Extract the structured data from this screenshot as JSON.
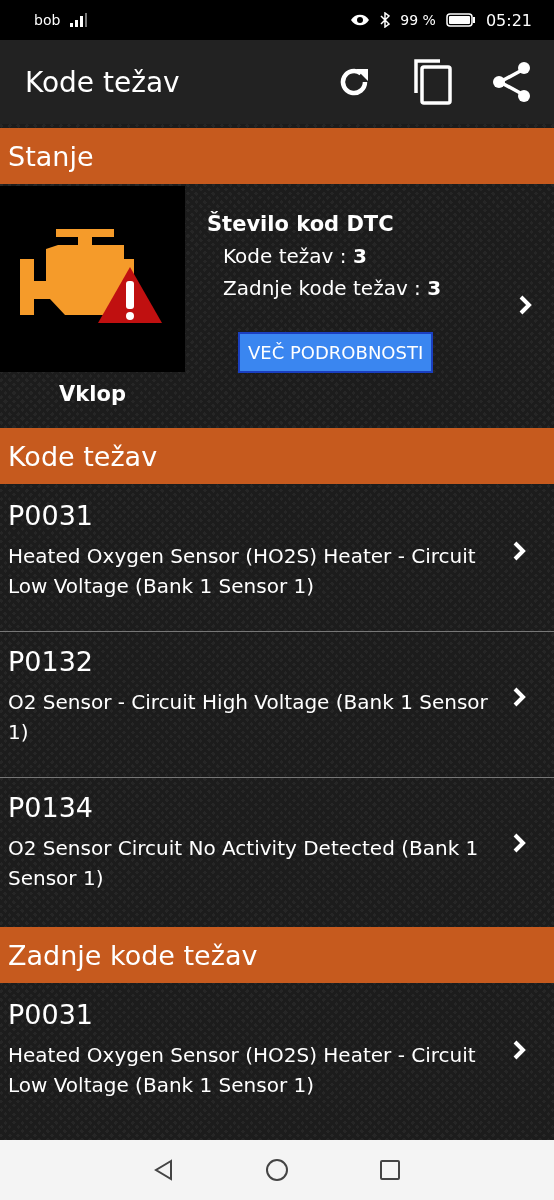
{
  "status_bar": {
    "carrier": "bob",
    "battery": "99 %",
    "time": "05:21"
  },
  "app_bar": {
    "title": "Kode težav"
  },
  "sections": [
    {
      "kind": "status",
      "title": "Stanje",
      "state": "Vklop",
      "heading": "Število kod DTC",
      "counts": [
        "Kode težav : **3**",
        "Zadnje kode težav : **3**"
      ],
      "button": "VEČ PODROBNOSTI"
    },
    {
      "kind": "codes",
      "title": "Kode težav",
      "items": [
        {
          "code": "P0031",
          "description": "Heated Oxygen Sensor (HO2S) Heater - Circuit Low Voltage (Bank 1 Sensor 1)"
        },
        {
          "code": "P0132",
          "description": "O2 Sensor - Circuit High Voltage (Bank 1 Sensor 1)"
        },
        {
          "code": "P0134",
          "description": "O2 Sensor Circuit No Activity Detected (Bank 1 Sensor 1)"
        }
      ]
    },
    {
      "kind": "codes",
      "title": "Zadnje kode težav",
      "items": [
        {
          "code": "P0031",
          "description": "Heated Oxygen Sensor (HO2S) Heater - Circuit Low Voltage (Bank 1 Sensor 1)"
        }
      ]
    }
  ]
}
